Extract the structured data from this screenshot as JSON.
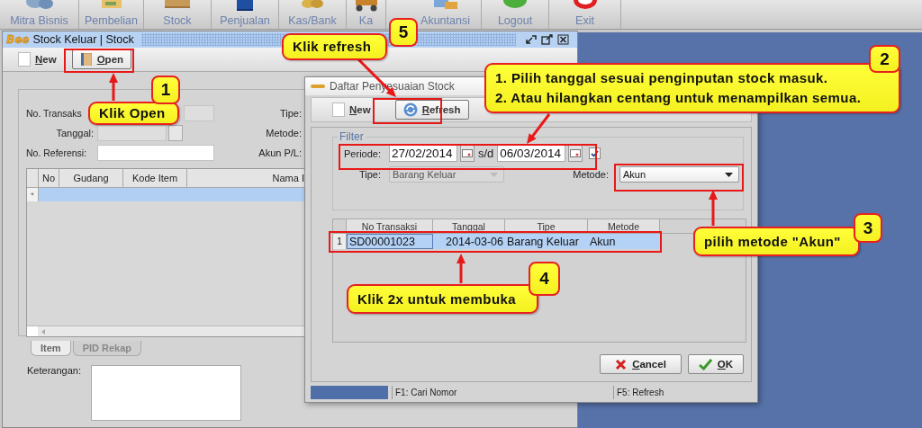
{
  "top_toolbar": {
    "items": [
      {
        "label": "Mitra Bisnis",
        "kind": "people"
      },
      {
        "label": "Pembelian",
        "kind": "purchase"
      },
      {
        "label": "Stock",
        "kind": "stock"
      },
      {
        "label": "Penjualan",
        "kind": "sales"
      },
      {
        "label": "Kas/Bank",
        "kind": "cash"
      },
      {
        "label": "Ka",
        "kind": "cart"
      },
      {
        "label": "Akuntansi",
        "kind": "accounting"
      },
      {
        "label": "Logout",
        "kind": "logout"
      },
      {
        "label": "Exit",
        "kind": "exit"
      }
    ]
  },
  "main_window": {
    "logo": "Bee",
    "title": "Stock Keluar | Stock",
    "toolbar": [
      {
        "label": "New",
        "kind": "new",
        "pressed": false
      },
      {
        "label": "Open",
        "kind": "open",
        "pressed": true
      }
    ],
    "form": {
      "left": [
        {
          "label": "No. Transaks",
          "kind": "readonly"
        },
        {
          "label": "Tanggal:",
          "kind": "date"
        },
        {
          "label": "No. Referensi:",
          "kind": "text"
        }
      ],
      "right": [
        "Tipe:",
        "Metode:",
        "Akun P/L:"
      ]
    },
    "grid": {
      "columns": [
        "No",
        "Gudang",
        "Kode Item",
        "Nama I"
      ],
      "new_row_marker": "*"
    },
    "tabs": [
      {
        "label": "Item",
        "selected": true
      },
      {
        "label": "PID Rekap",
        "selected": false
      }
    ],
    "notes_label": "Keterangan:"
  },
  "dialog": {
    "title": "Daftar Penyesuaian Stock",
    "toolbar": [
      {
        "label": "New",
        "kind": "new",
        "pressed": false
      },
      {
        "label": "Refresh",
        "kind": "refresh",
        "pressed": true
      }
    ],
    "filter": {
      "legend": "Filter",
      "period_label": "Periode:",
      "date_from": "27/02/2014",
      "separator": "s/d",
      "date_to": "06/03/2014",
      "period_enabled": true,
      "type_label": "Tipe:",
      "type_value": "Barang Keluar",
      "type_disabled": true,
      "method_label": "Metode:",
      "method_value": "Akun"
    },
    "table": {
      "columns": [
        "No Transaksi",
        "Tanggal",
        "Tipe",
        "Metode"
      ],
      "rows": [
        {
          "index": "1",
          "cells": [
            "SD00001023",
            "2014-03-06",
            "Barang Keluar",
            "Akun"
          ],
          "selected": true
        }
      ]
    },
    "buttons": [
      {
        "label": "Cancel",
        "kind": "cancel"
      },
      {
        "label": "OK",
        "kind": "ok"
      }
    ],
    "status_bar": [
      "F1: Cari Nomor",
      "F5: Refresh"
    ]
  },
  "annotations": [
    {
      "number": "1",
      "lines": [
        "Klik Open"
      ]
    },
    {
      "number": "2",
      "lines": [
        "1. Pilih tanggal sesuai penginputan stock masuk.",
        "2. Atau hilangkan centang untuk menampilkan semua."
      ]
    },
    {
      "number": "3",
      "lines": [
        "pilih metode \"Akun\""
      ]
    },
    {
      "number": "4",
      "lines": [
        "Klik 2x untuk membuka"
      ]
    },
    {
      "number": "5",
      "lines": [
        "Klik refresh"
      ]
    }
  ]
}
